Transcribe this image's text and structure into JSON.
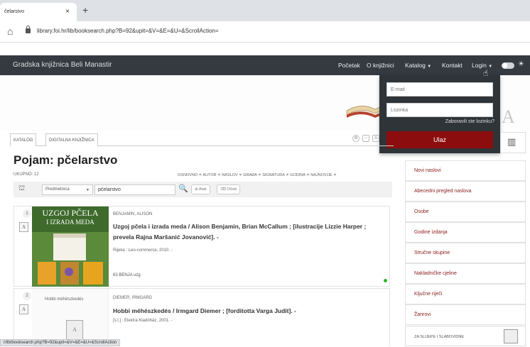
{
  "browser": {
    "tab_title": "čelarstvo",
    "tab_close": "×",
    "new_tab": "+",
    "url": "library.foi.hr/lib/booksearch.php?B=92&upit=&V=&E=&U=&ScrollAction="
  },
  "navbar": {
    "brand": "Gradska knjižnica Beli Manastir",
    "links": [
      "Početak",
      "O knjižnici",
      "Katalog",
      "Kontakt",
      "Login"
    ]
  },
  "login": {
    "email_placeholder": "E-mail",
    "password_placeholder": "Lozinka",
    "forgot": "Zaboravili ste lozinku?",
    "submit": "Ulaz"
  },
  "catalog_tabs": [
    "KATALOG",
    "DIGITALNA KNJIŽNICA"
  ],
  "results": {
    "title": "Pojam: pčelarstvo",
    "total": "UKUPNO: 12",
    "sort": "OSNOVNO ≑  AUTOR ≑  NASLOV ≑  GRAĐA ≑  SIGNATURA ≑  GODINA ≑  NAJNOVIJE ≑",
    "search_type": "Predmetnica",
    "search_value": "pčelarstvo",
    "actions": [
      "Alati",
      "Očisti"
    ]
  },
  "items": [
    {
      "number": "1",
      "author": "BENJAMIN, ALISON",
      "title": "Uzgoj pčela i izrada meda / Alison Benjamin, Brian McCallum ; [ilustracije Lizzie Harper ; prevela Rajna Maršanić Jovanović]. -",
      "publisher": "Rijeka : Leo-commerce, 2010. -",
      "call_number": "63 BENJA uzg",
      "cover_title": "UZGOJ PČELA",
      "cover_subtitle": "I IZRADA MEDA",
      "available_color": "#2db32d"
    },
    {
      "number": "2",
      "author": "DIEMER, IRMGARD",
      "title": "Hobbi méhészkedés / Irmgard Diemer ; [forditotta Varga Judit]. -",
      "publisher": "[s.l.] : Elektra Kiadóház, 2001. -",
      "cover_title": "Hobbi méhészkedés"
    }
  ],
  "sidebar": {
    "items": [
      "Novi naslovi",
      "Abecedni pregled naslova",
      "Osobe",
      "Godine izdanja",
      "Stručne skupine",
      "Nakladničke cjeline",
      "Ključne riječi",
      "Žanrovi"
    ],
    "box_label": "ZA SLIJEPE I SLABOVIDNE"
  },
  "status_url": "r/lib/booksearch.php?B=92&upit=&V=&E=&U=&ScrollAction",
  "colors": {
    "navbar": "#343a40",
    "login_button": "#8b0d0d",
    "sidebar_link": "#8b1a1a"
  }
}
